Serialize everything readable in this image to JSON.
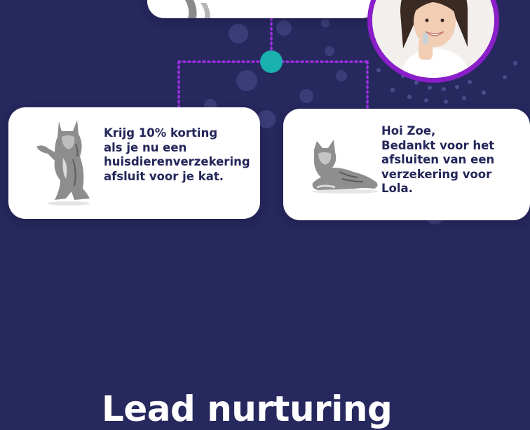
{
  "colors": {
    "background": "#26285e",
    "card": "#ffffff",
    "text": "#24265a",
    "connector_dots": "#9b30e0",
    "node": "#1ab0b0",
    "avatar_ring": "#8a1ec8"
  },
  "cards": {
    "left": {
      "message": "Krijg 10% korting\nals je nu een\nhuisdierenverzekering\nafsluit voor je kat.",
      "image": "cat-standing-illustration"
    },
    "right": {
      "message": "Hoi Zoe,\nBedankt voor het\nafsluiten van een\nverzekering voor\nLola.",
      "image": "cat-lying-illustration"
    }
  },
  "avatar": {
    "image": "smiling-woman-portrait"
  },
  "heading": {
    "title": "Lead nurturing"
  }
}
